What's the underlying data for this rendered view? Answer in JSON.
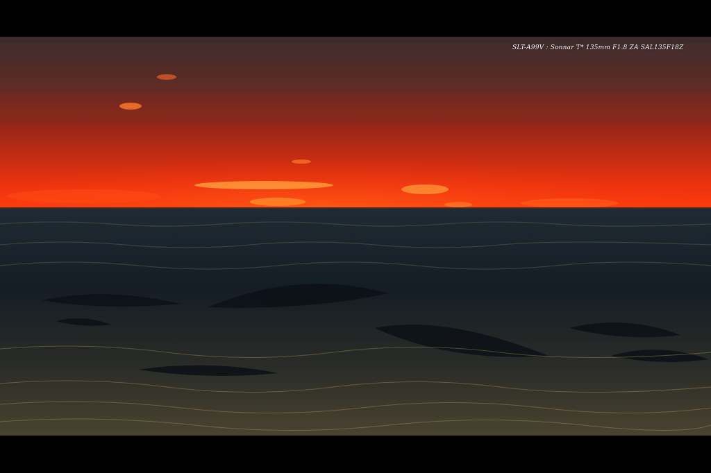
{
  "photo": {
    "subject": "sunset-over-sea",
    "caption": "SLT-A99V : Sonnar T* 135mm F1.8 ZA SAL135F18Z"
  },
  "colors": {
    "sky_top": "#3e2a2a",
    "sky_mid": "#a52a1c",
    "horizon_glow": "#ff3a10",
    "cloud_highlight": "#ff9a3a",
    "sea_dark": "#12181d",
    "sea_highlight": "#c8a860",
    "letterbox": "#000000"
  }
}
